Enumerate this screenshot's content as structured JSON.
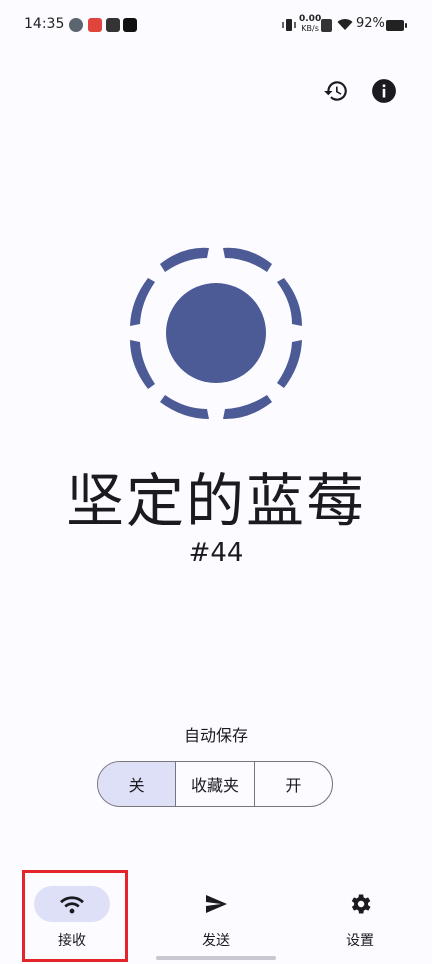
{
  "status_bar": {
    "time": "14:35",
    "net_speed_value": "0.00",
    "net_speed_unit": "KB/s",
    "battery": "92%"
  },
  "header": {
    "history_icon": "history-icon",
    "info_icon": "info-icon"
  },
  "device": {
    "name": "坚定的蓝莓",
    "id": "#44",
    "logo_color": "#4c5b95"
  },
  "autosave": {
    "label": "自动保存",
    "options": [
      "关",
      "收藏夹",
      "开"
    ],
    "selected": "关"
  },
  "bottom_nav": {
    "items": [
      {
        "label": "接收",
        "icon": "wifi-icon",
        "active": true
      },
      {
        "label": "发送",
        "icon": "send-icon",
        "active": false
      },
      {
        "label": "设置",
        "icon": "gear-icon",
        "active": false
      }
    ]
  },
  "colors": {
    "accent": "#4c5b95",
    "selected_bg": "#dee0f8",
    "highlight": "#e5232b"
  }
}
